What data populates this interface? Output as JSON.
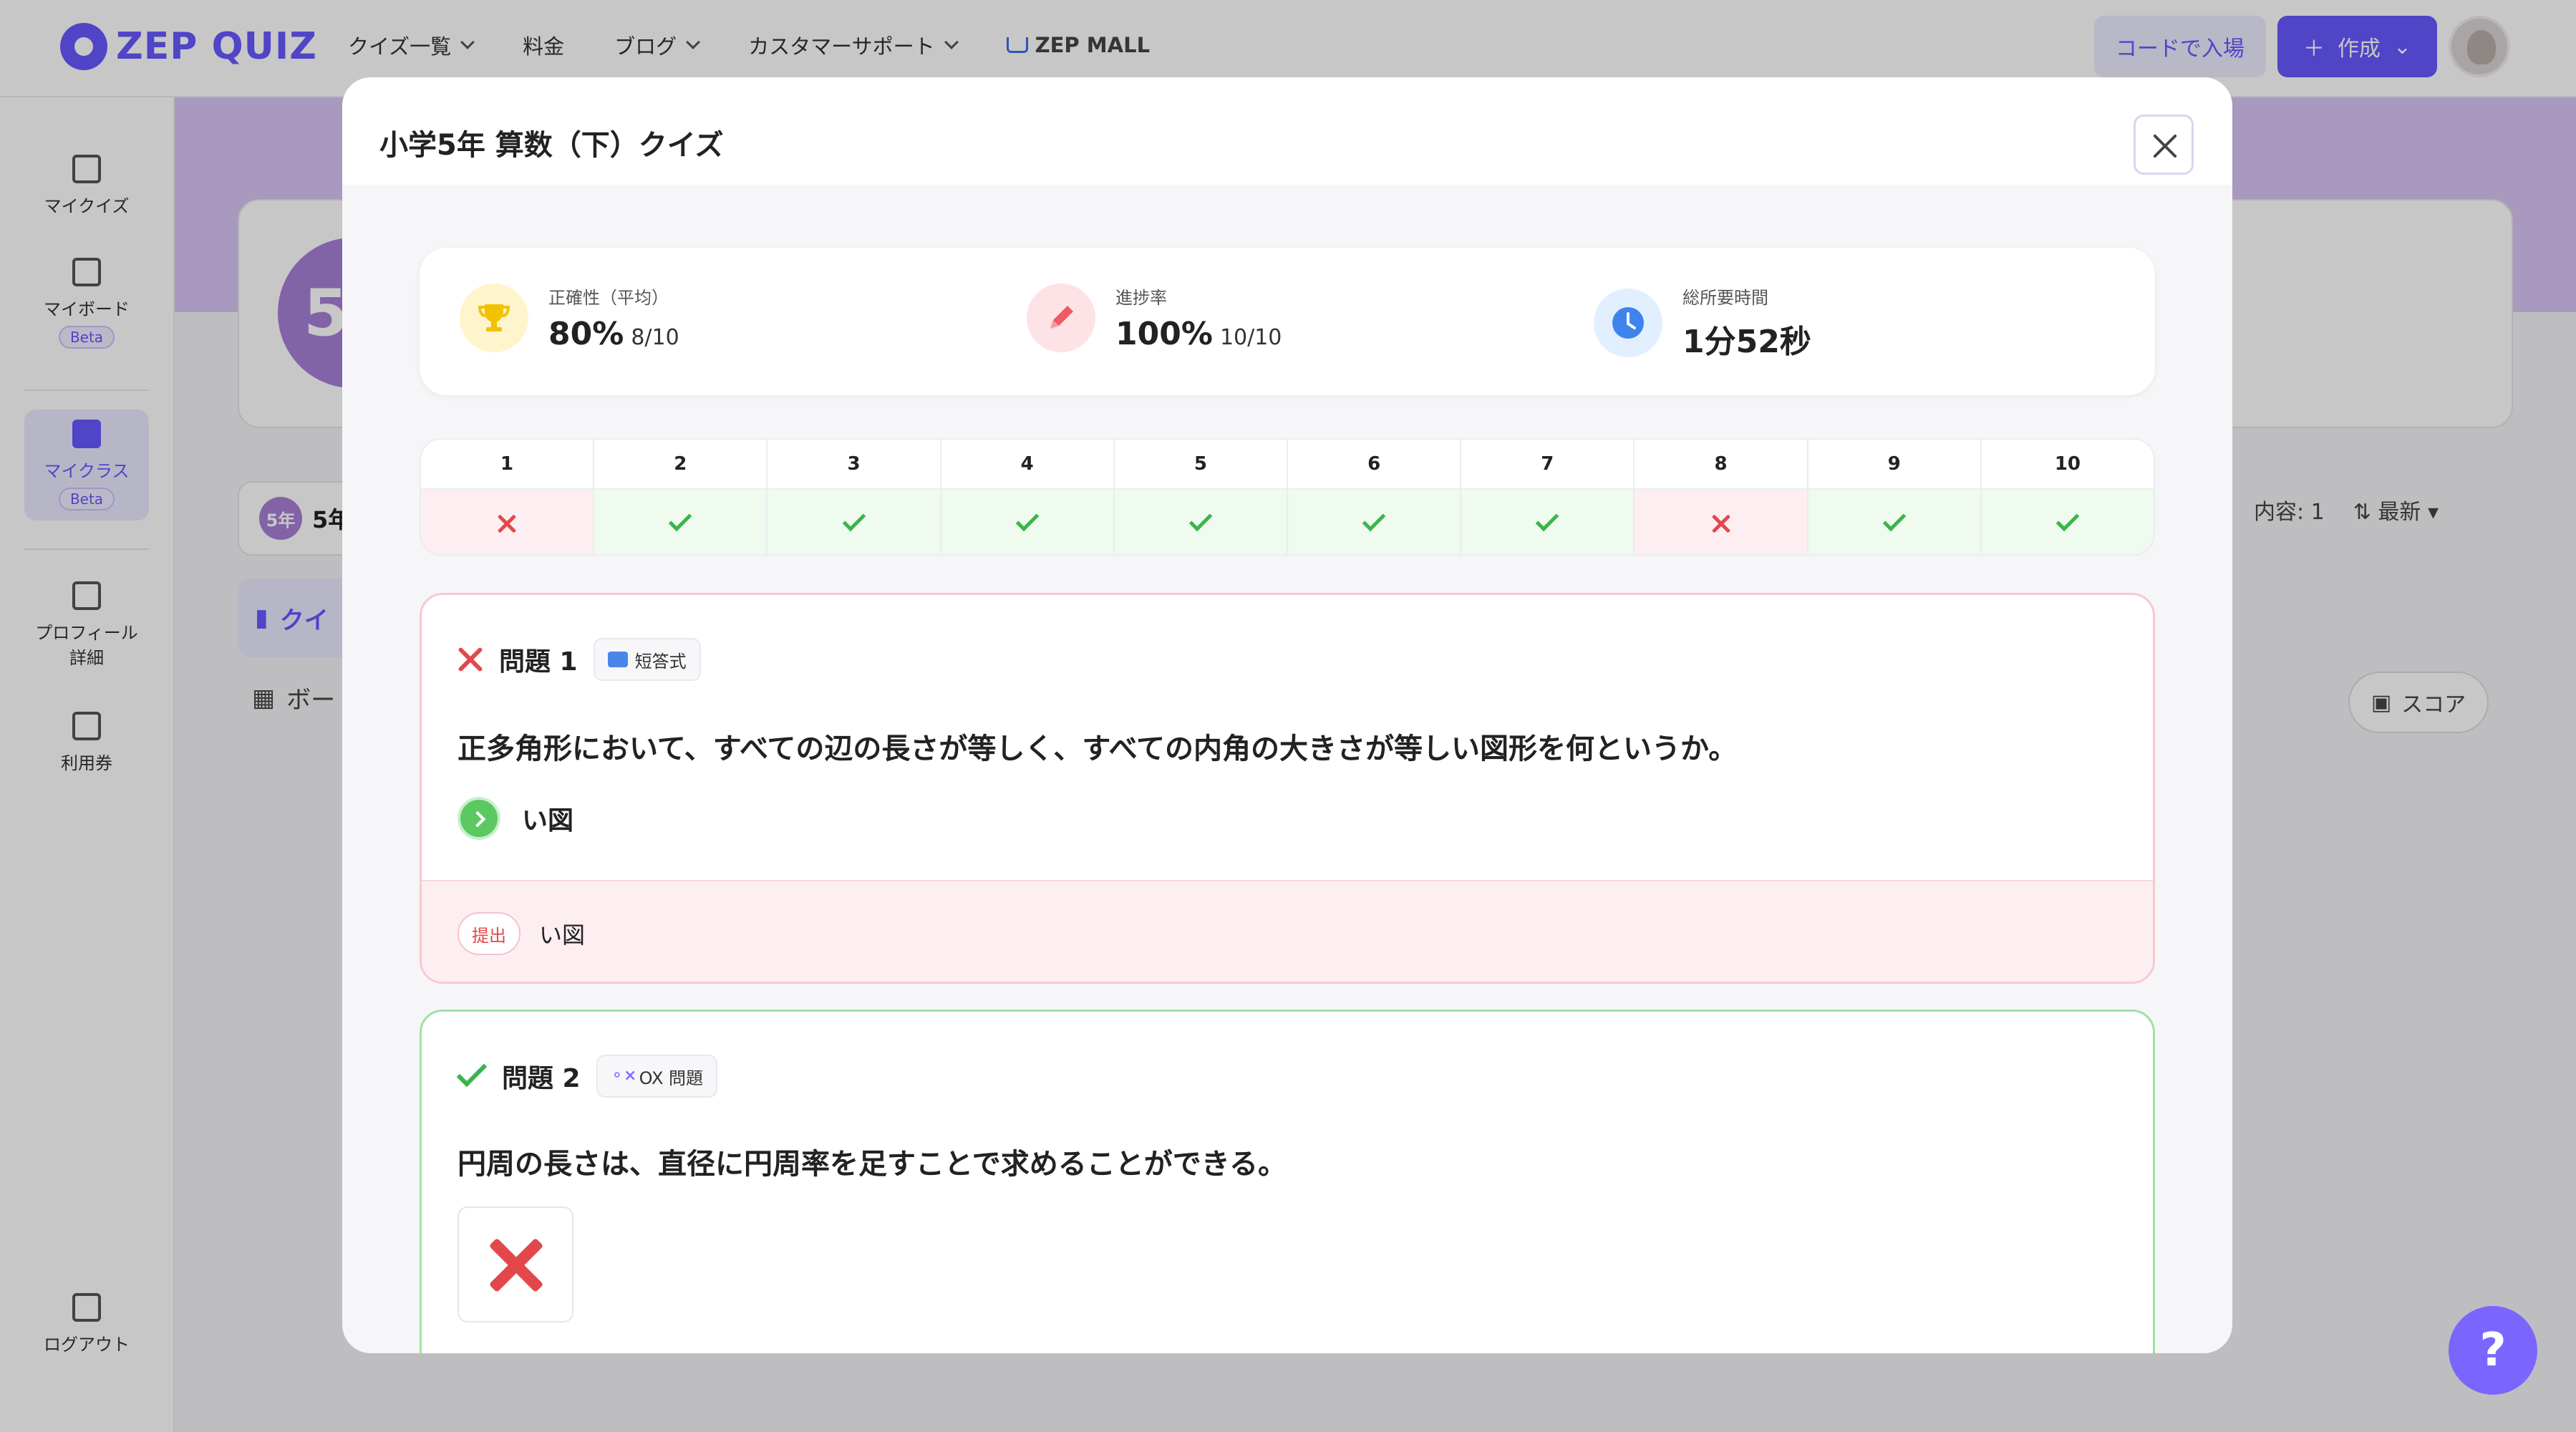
{
  "app": {
    "logo_text": "ZEP QUIZ"
  },
  "topnav": {
    "items": [
      "クイズ一覧",
      "料金",
      "ブログ",
      "カスタマーサポート"
    ],
    "mall": "ZEP MALL",
    "code_button": "コードで入場",
    "create_button": "作成"
  },
  "sidebar": {
    "my_quiz": "マイクイズ",
    "my_board": "マイボード",
    "my_class": "マイクラス",
    "beta": "Beta",
    "profile": "プロフィール\n詳細",
    "coupon": "利用券",
    "logout": "ログアウト"
  },
  "background": {
    "class_circle": "5",
    "tab_pill": "5年",
    "tab_label": "5年",
    "menu_quiz": "クイ",
    "menu_board": "ボー",
    "content_count": "内容: 1",
    "sort": "最新",
    "score_button": "スコア"
  },
  "modal": {
    "title": "小学5年 算数（下）クイズ",
    "stats": [
      {
        "label": "正確性（平均）",
        "value": "80%",
        "sub": "8/10"
      },
      {
        "label": "進捗率",
        "value": "100%",
        "sub": "10/10"
      },
      {
        "label": "総所要時間",
        "value": "1分52秒",
        "sub": ""
      }
    ],
    "results": [
      {
        "num": "1",
        "correct": false
      },
      {
        "num": "2",
        "correct": true
      },
      {
        "num": "3",
        "correct": true
      },
      {
        "num": "4",
        "correct": true
      },
      {
        "num": "5",
        "correct": true
      },
      {
        "num": "6",
        "correct": true
      },
      {
        "num": "7",
        "correct": true
      },
      {
        "num": "8",
        "correct": false
      },
      {
        "num": "9",
        "correct": true
      },
      {
        "num": "10",
        "correct": true
      }
    ],
    "questions": [
      {
        "label": "問題 1",
        "type": "短答式",
        "text": "正多角形において、すべての辺の長さが等しく、すべての内角の大きさが等しい図形を何というか。",
        "answer": "い図",
        "submit_label": "提出",
        "submitted": "い図"
      },
      {
        "label": "問題 2",
        "type": "OX 問題",
        "text": "円周の長さは、直径に円周率を足すことで求めることができる。"
      }
    ]
  },
  "colors": {
    "accent": "#6758ff",
    "correct": "#3bb54a",
    "wrong": "#e2484b"
  }
}
